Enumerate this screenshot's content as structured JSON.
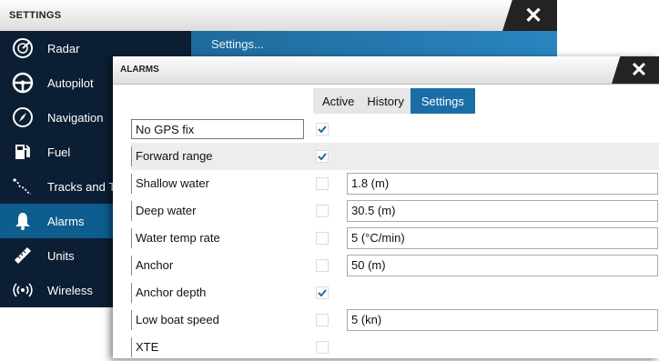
{
  "settings": {
    "title": "SETTINGS",
    "close_icon": "close-icon",
    "subheader": "Settings...",
    "accent_color": "#0e5d8f",
    "sidebar": [
      {
        "label": "Radar",
        "icon": "radar-icon",
        "active": false
      },
      {
        "label": "Autopilot",
        "icon": "steering-wheel-icon",
        "active": false
      },
      {
        "label": "Navigation",
        "icon": "compass-icon",
        "active": false
      },
      {
        "label": "Fuel",
        "icon": "fuel-pump-icon",
        "active": false
      },
      {
        "label": "Tracks and Tr",
        "icon": "tracks-icon",
        "active": false
      },
      {
        "label": "Alarms",
        "icon": "bell-icon",
        "active": true
      },
      {
        "label": "Units",
        "icon": "ruler-icon",
        "active": false
      },
      {
        "label": "Wireless",
        "icon": "wireless-icon",
        "active": false
      }
    ]
  },
  "alarms": {
    "title": "ALARMS",
    "close_icon": "close-icon",
    "tabs": [
      {
        "label": "Active",
        "active": false
      },
      {
        "label": "History",
        "active": false
      },
      {
        "label": "Settings",
        "active": true
      }
    ],
    "rows": [
      {
        "label": "No GPS fix",
        "checked": true,
        "value": null
      },
      {
        "label": "Forward range",
        "checked": true,
        "value": null
      },
      {
        "label": "Shallow water",
        "checked": false,
        "value": "1.8 (m)"
      },
      {
        "label": "Deep water",
        "checked": false,
        "value": "30.5 (m)"
      },
      {
        "label": "Water temp rate",
        "checked": false,
        "value": "5 (°C/min)"
      },
      {
        "label": "Anchor",
        "checked": false,
        "value": "50 (m)"
      },
      {
        "label": "Anchor depth",
        "checked": true,
        "value": null
      },
      {
        "label": "Low boat speed",
        "checked": false,
        "value": "5 (kn)"
      },
      {
        "label": "XTE",
        "checked": false,
        "value": null
      }
    ]
  }
}
